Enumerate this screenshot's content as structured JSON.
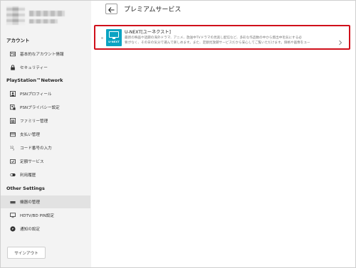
{
  "sidebar": {
    "sections": [
      {
        "heading": "アカウント"
      },
      {
        "heading": "PlayStation™Network"
      },
      {
        "heading": "Other Settings"
      }
    ],
    "items": [
      {
        "label": "基本的なアカウント情報",
        "icon": "id-card-icon"
      },
      {
        "label": "セキュリティー",
        "icon": "lock-icon"
      },
      {
        "label": "PSNプロフィール",
        "icon": "profile-icon"
      },
      {
        "label": "PSNプライバシー設定",
        "icon": "privacy-icon"
      },
      {
        "label": "ファミリー管理",
        "icon": "family-icon"
      },
      {
        "label": "支払い管理",
        "icon": "credit-card-icon"
      },
      {
        "label": "コード番号の入力",
        "icon": "code-icon"
      },
      {
        "label": "定額サービス",
        "icon": "subscription-icon"
      },
      {
        "label": "利用履歴",
        "icon": "toggle-icon"
      },
      {
        "label": "機器の管理",
        "icon": "device-icon",
        "active": true
      },
      {
        "label": "HDTV/BD PIN設定",
        "icon": "monitor-icon"
      },
      {
        "label": "通知の設定",
        "icon": "notification-icon"
      }
    ],
    "signout_label": "サインアウト"
  },
  "main": {
    "title": "プレミアムサービス",
    "service": {
      "name": "U-NEXT[ユーネクスト]",
      "logo_text": "U-NEXT",
      "description_line1": "最新の映画や話題の海外ドラマ、アニメ、放送中TVドラマの見逃し配信など、多彩な作品数の中から資出中毛気にする必",
      "description_line2": "要がなく、その日の気分で選んで楽しめます。また、定額見放題サービスだから安心してご覧いただけます。価格や画像をユー"
    }
  },
  "colors": {
    "highlight_border": "#d0101b",
    "logo_bg": "#0aa3c2",
    "sidebar_bg": "#f3f3f3"
  }
}
